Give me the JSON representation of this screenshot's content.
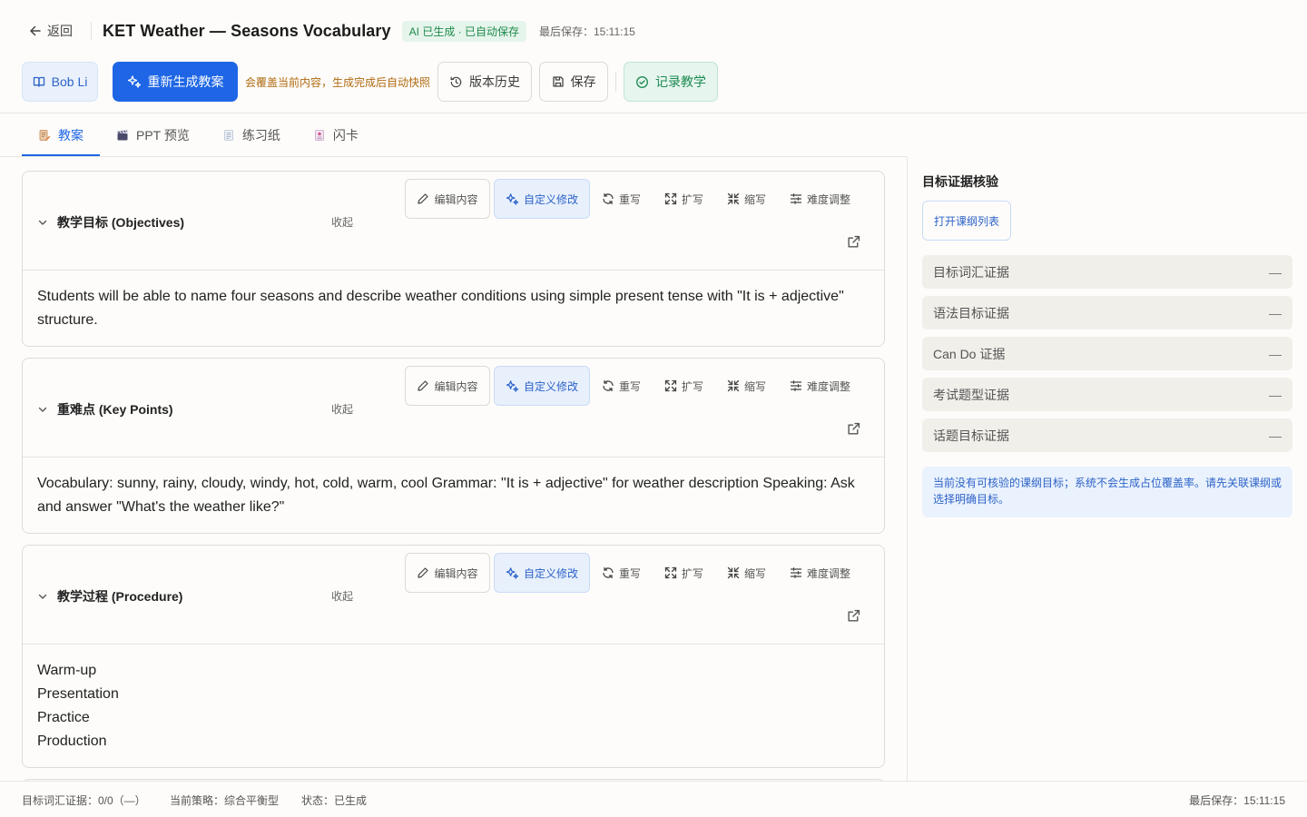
{
  "header": {
    "back_label": "返回",
    "title": "KET Weather — Seasons Vocabulary",
    "status_badge": "AI 已生成 · 已自动保存",
    "last_saved": "最后保存：15:11:15"
  },
  "toolbar": {
    "user_label": "Bob Li",
    "regenerate_label": "重新生成教案",
    "regenerate_warning": "会覆盖当前内容，生成完成后自动快照",
    "history_label": "版本历史",
    "save_label": "保存",
    "record_label": "记录教学"
  },
  "tabs": [
    {
      "label": "教案",
      "active": true
    },
    {
      "label": "PPT 预览",
      "active": false
    },
    {
      "label": "练习纸",
      "active": false
    },
    {
      "label": "闪卡",
      "active": false
    }
  ],
  "card_actions": {
    "edit": "编辑内容",
    "custom": "自定义修改",
    "rewrite": "重写",
    "expand": "扩写",
    "shrink": "缩写",
    "difficulty": "难度调整",
    "collapse": "收起"
  },
  "sections": [
    {
      "title": "教学目标 (Objectives)",
      "body": "Students will be able to name four seasons and describe weather conditions using simple present tense with \"It is + adjective\" structure."
    },
    {
      "title": "重难点 (Key Points)",
      "body": "Vocabulary: sunny, rainy, cloudy, windy, hot, cold, warm, cool Grammar: \"It is + adjective\" for weather description Speaking: Ask and answer \"What's the weather like?\""
    },
    {
      "title": "教学过程 (Procedure)",
      "lines": [
        "Warm-up",
        "Presentation",
        "Practice",
        "Production"
      ]
    }
  ],
  "right_panel": {
    "title": "目标证据核验",
    "open_syllabus": "打开课纲列表",
    "evidence": [
      {
        "label": "目标词汇证据",
        "value": "—"
      },
      {
        "label": "语法目标证据",
        "value": "—"
      },
      {
        "label": "Can Do 证据",
        "value": "—"
      },
      {
        "label": "考试题型证据",
        "value": "—"
      },
      {
        "label": "话题目标证据",
        "value": "—"
      }
    ],
    "notice": "当前没有可核验的课纲目标；系统不会生成占位覆盖率。请先关联课纲或选择明确目标。"
  },
  "footer": {
    "vocab_evidence": "目标词汇证据：0/0（—）",
    "strategy": "当前策略：综合平衡型",
    "status": "状态：已生成",
    "last_saved": "最后保存：15:11:15"
  },
  "colors": {
    "primary": "#1e66e6",
    "success": "#1d8a52",
    "warning": "#b06a10",
    "panel_bg": "#f1efea",
    "info_bg": "#eaf2fd"
  }
}
